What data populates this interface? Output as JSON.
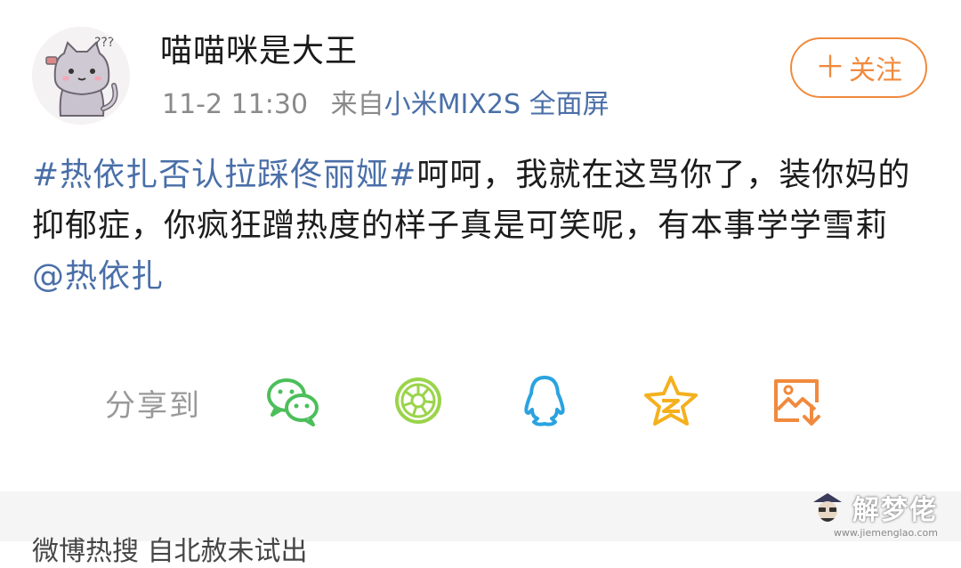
{
  "user": {
    "name": "喵喵咪是大王",
    "time": "11-2 11:30",
    "source_prefix": "来自",
    "source": "小米MIX2S 全面屏",
    "avatar_icon": "cat-avatar-icon"
  },
  "follow": {
    "plus": "＋",
    "label": "关注",
    "color": "#f08a3e"
  },
  "post": {
    "hashtag": "#热依扎否认拉踩佟丽娅#",
    "body": "呵呵，我就在这骂你了，装你妈的抑郁症，你疯狂蹭热度的样子真是可笑呢，有本事学学雪莉",
    "mention": "@热依扎",
    "link_color": "#4a6fa8"
  },
  "share": {
    "label": "分享到",
    "icons": [
      "wechat-icon",
      "moments-icon",
      "qq-icon",
      "qzone-icon",
      "save-image-icon"
    ]
  },
  "watermark": {
    "text": "解梦佬",
    "url": "www.jiemenglao.com"
  },
  "next_item_peek": "微博热搜 自北赦未试出"
}
